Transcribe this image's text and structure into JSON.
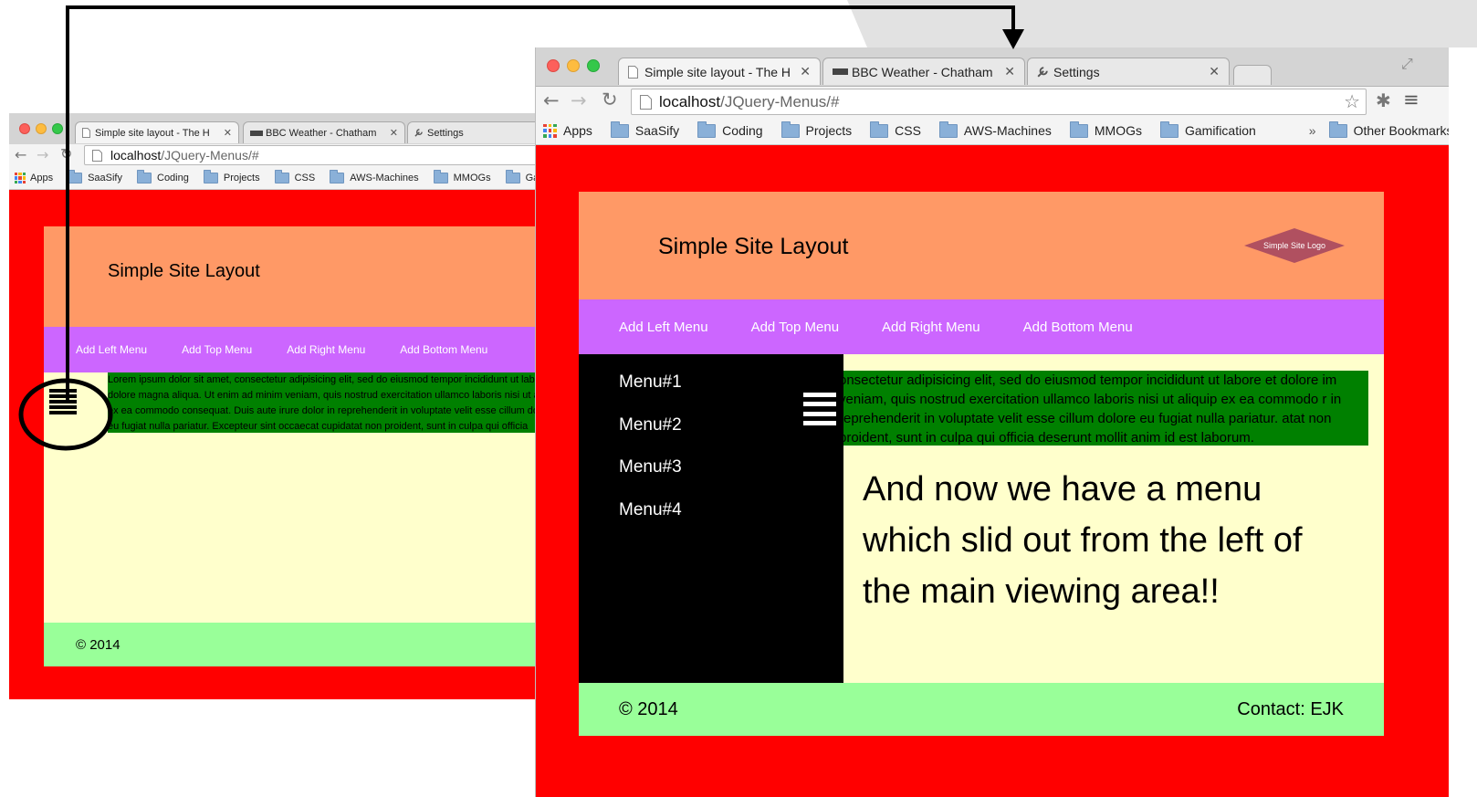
{
  "colors": {
    "page_bg": "#ff0000",
    "header": "#ff9966",
    "nav": "#cc66ff",
    "main": "#ffffcc",
    "lorem": "#008000",
    "footer": "#99ff99",
    "sidemenu": "#000000",
    "logo": "#b05060"
  },
  "icons": {
    "hamburger": "hamburger-icon",
    "page": "page-icon",
    "folder": "folder-icon",
    "apps": "apps-grid-icon",
    "star": "star-icon",
    "menu": "chrome-menu-icon",
    "extension": "extension-icon",
    "back": "back-arrow-icon",
    "forward": "forward-arrow-icon",
    "reload": "reload-icon",
    "settings": "wrench-icon",
    "bbc": "bbc-icon",
    "fullscreen": "fullscreen-icon"
  },
  "small": {
    "tabs": [
      {
        "label": "Simple site layout - The H"
      },
      {
        "label": "BBC Weather - Chatham"
      },
      {
        "label": "Settings"
      }
    ],
    "url_host": "localhost",
    "url_path": "/JQuery-Menus/#",
    "bookmarks": [
      "Apps",
      "SaaSify",
      "Coding",
      "Projects",
      "CSS",
      "AWS-Machines",
      "MMOGs",
      "Gamifi"
    ],
    "site_title": "Simple Site Layout",
    "nav": [
      "Add Left Menu",
      "Add Top Menu",
      "Add Right Menu",
      "Add Bottom Menu"
    ],
    "lorem": "Lorem ipsum dolor sit amet, consectetur adipisicing elit, sed do eiusmod tempor incididunt ut labore et dolore magna aliqua. Ut enim ad minim veniam, quis nostrud exercitation ullamco laboris nisi ut aliquip ex ea commodo consequat. Duis aute irure dolor in reprehenderit in voluptate velit esse cillum dolore eu fugiat nulla pariatur. Excepteur sint occaecat cupidatat non proident, sunt in culpa qui officia deserunt mollit anim id est laborum.",
    "footer_copy": "© 2014"
  },
  "large": {
    "tabs": [
      {
        "label": "Simple site layout - The H"
      },
      {
        "label": "BBC Weather - Chatham"
      },
      {
        "label": "Settings"
      }
    ],
    "url_host": "localhost",
    "url_path": "/JQuery-Menus/#",
    "bookmarks": [
      "Apps",
      "SaaSify",
      "Coding",
      "Projects",
      "CSS",
      "AWS-Machines",
      "MMOGs",
      "Gamification"
    ],
    "bookmarks_overflow": "»",
    "other_bookmarks": "Other Bookmarks",
    "site_title": "Simple Site Layout",
    "logo_text": "Simple Site Logo",
    "nav": [
      "Add Left Menu",
      "Add Top Menu",
      "Add Right Menu",
      "Add Bottom Menu"
    ],
    "menu_items": [
      "Menu#1",
      "Menu#2",
      "Menu#3",
      "Menu#4"
    ],
    "lorem": "onsectetur adipisicing elit, sed do eiusmod tempor incididunt ut labore et dolore im veniam, quis nostrud exercitation ullamco laboris nisi ut aliquip ex ea commodo r in reprehenderit in voluptate velit esse cillum dolore eu fugiat nulla pariatur. atat non proident, sunt in culpa qui officia deserunt mollit anim id est laborum.",
    "big_text": "And now we have a menu which slid out from the left of the main viewing area!!",
    "footer_copy": "© 2014",
    "footer_contact": "Contact: EJK"
  }
}
